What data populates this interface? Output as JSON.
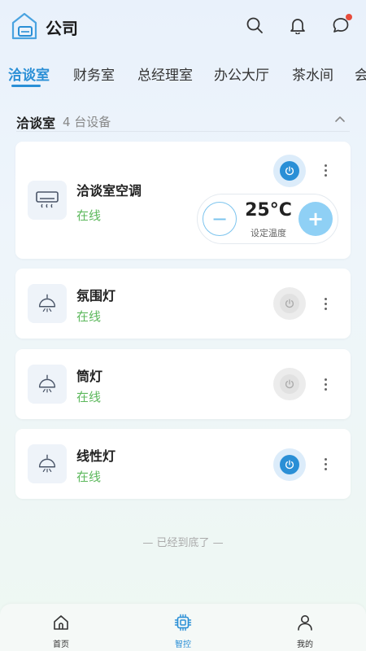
{
  "header": {
    "title": "公司",
    "notification_dot_color": "#e74c3c"
  },
  "tabs": [
    {
      "label": "洽谈室",
      "active": true
    },
    {
      "label": "财务室",
      "active": false
    },
    {
      "label": "总经理室",
      "active": false
    },
    {
      "label": "办公大厅",
      "active": false
    },
    {
      "label": "茶水间",
      "active": false
    },
    {
      "label": "会",
      "active": false
    }
  ],
  "section": {
    "title": "洽谈室",
    "count": "4 台设备",
    "expanded": true
  },
  "devices": [
    {
      "name": "洽谈室空调",
      "status": "在线",
      "icon": "air-conditioner-icon",
      "power": "on",
      "temperature": {
        "value": "25°C",
        "label": "设定温度",
        "minus": "−",
        "plus": "+"
      }
    },
    {
      "name": "氛围灯",
      "status": "在线",
      "icon": "pendant-lamp-icon",
      "power": "off"
    },
    {
      "name": "筒灯",
      "status": "在线",
      "icon": "pendant-lamp-icon",
      "power": "off"
    },
    {
      "name": "线性灯",
      "status": "在线",
      "icon": "pendant-lamp-icon",
      "power": "on"
    }
  ],
  "end_text": "— 已经到底了 —",
  "bottom_nav": [
    {
      "label": "首页",
      "icon": "home-icon",
      "active": false
    },
    {
      "label": "智控",
      "icon": "chip-icon",
      "active": true
    },
    {
      "label": "我的",
      "icon": "user-icon",
      "active": false
    }
  ],
  "colors": {
    "accent": "#2a8fd6",
    "online": "#5cb85c",
    "power_on": "#2a8fd6",
    "power_off": "#e1e1e1"
  }
}
